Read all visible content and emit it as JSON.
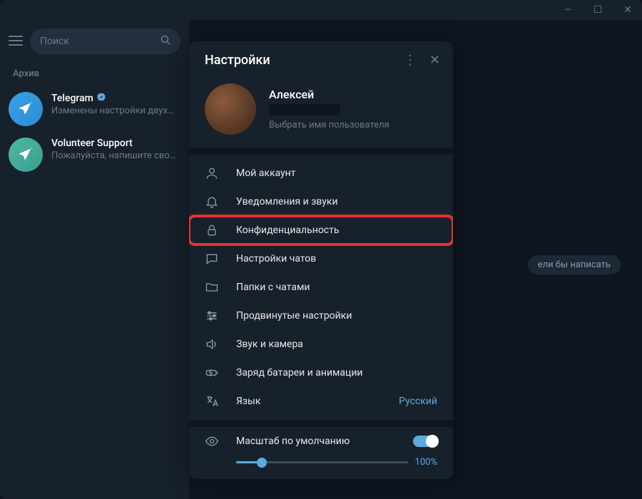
{
  "titlebar": {
    "min": "—",
    "max": "☐",
    "close": "✕"
  },
  "sidebar": {
    "search_placeholder": "Поиск",
    "archive_label": "Архив",
    "chats": [
      {
        "title": "Telegram",
        "verified": true,
        "preview": "Изменены настройки двух…"
      },
      {
        "title": "Volunteer Support",
        "verified": false,
        "preview": "Пожалуйста, напишите сво…"
      }
    ]
  },
  "content_hint": "ели бы написать",
  "settings": {
    "title": "Настройки",
    "profile": {
      "name": "Алексей",
      "username_hint": "Выбрать имя пользователя"
    },
    "items": [
      {
        "id": "account",
        "label": "Мой аккаунт"
      },
      {
        "id": "notifications",
        "label": "Уведомления и звуки"
      },
      {
        "id": "privacy",
        "label": "Конфиденциальность",
        "highlighted": true
      },
      {
        "id": "chats",
        "label": "Настройки чатов"
      },
      {
        "id": "folders",
        "label": "Папки с чатами"
      },
      {
        "id": "advanced",
        "label": "Продвинутые настройки"
      },
      {
        "id": "sound",
        "label": "Звук и камера"
      },
      {
        "id": "battery",
        "label": "Заряд батареи и анимации"
      },
      {
        "id": "language",
        "label": "Язык",
        "value": "Русский"
      }
    ],
    "scale": {
      "label": "Масштаб по умолчанию",
      "value": "100%"
    }
  }
}
